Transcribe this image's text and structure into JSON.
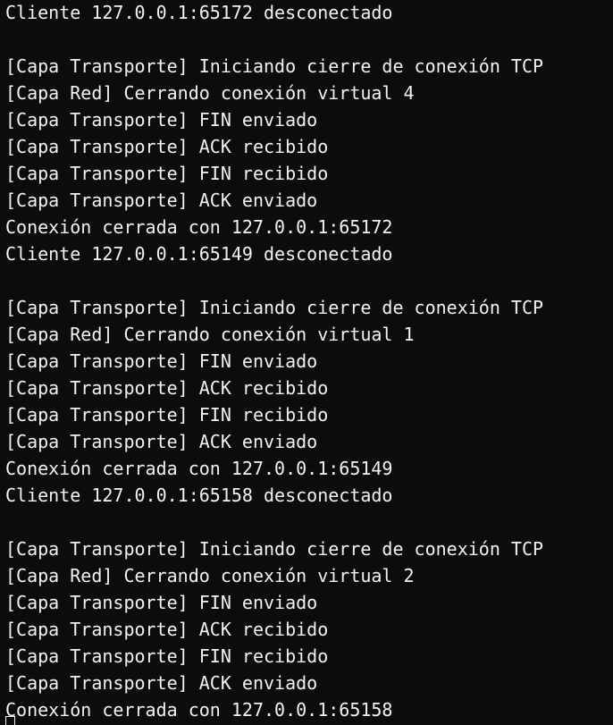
{
  "colors": {
    "background": "#0c0c0c",
    "foreground": "#f2f2f2"
  },
  "cursor_icon": "block-cursor",
  "console": {
    "lines": [
      "Cliente 127.0.0.1:65172 desconectado",
      "",
      "[Capa Transporte] Iniciando cierre de conexión TCP",
      "[Capa Red] Cerrando conexión virtual 4",
      "[Capa Transporte] FIN enviado",
      "[Capa Transporte] ACK recibido",
      "[Capa Transporte] FIN recibido",
      "[Capa Transporte] ACK enviado",
      "Conexión cerrada con 127.0.0.1:65172",
      "Cliente 127.0.0.1:65149 desconectado",
      "",
      "[Capa Transporte] Iniciando cierre de conexión TCP",
      "[Capa Red] Cerrando conexión virtual 1",
      "[Capa Transporte] FIN enviado",
      "[Capa Transporte] ACK recibido",
      "[Capa Transporte] FIN recibido",
      "[Capa Transporte] ACK enviado",
      "Conexión cerrada con 127.0.0.1:65149",
      "Cliente 127.0.0.1:65158 desconectado",
      "",
      "[Capa Transporte] Iniciando cierre de conexión TCP",
      "[Capa Red] Cerrando conexión virtual 2",
      "[Capa Transporte] FIN enviado",
      "[Capa Transporte] ACK recibido",
      "[Capa Transporte] FIN recibido",
      "[Capa Transporte] ACK enviado",
      "Conexión cerrada con 127.0.0.1:65158"
    ]
  }
}
